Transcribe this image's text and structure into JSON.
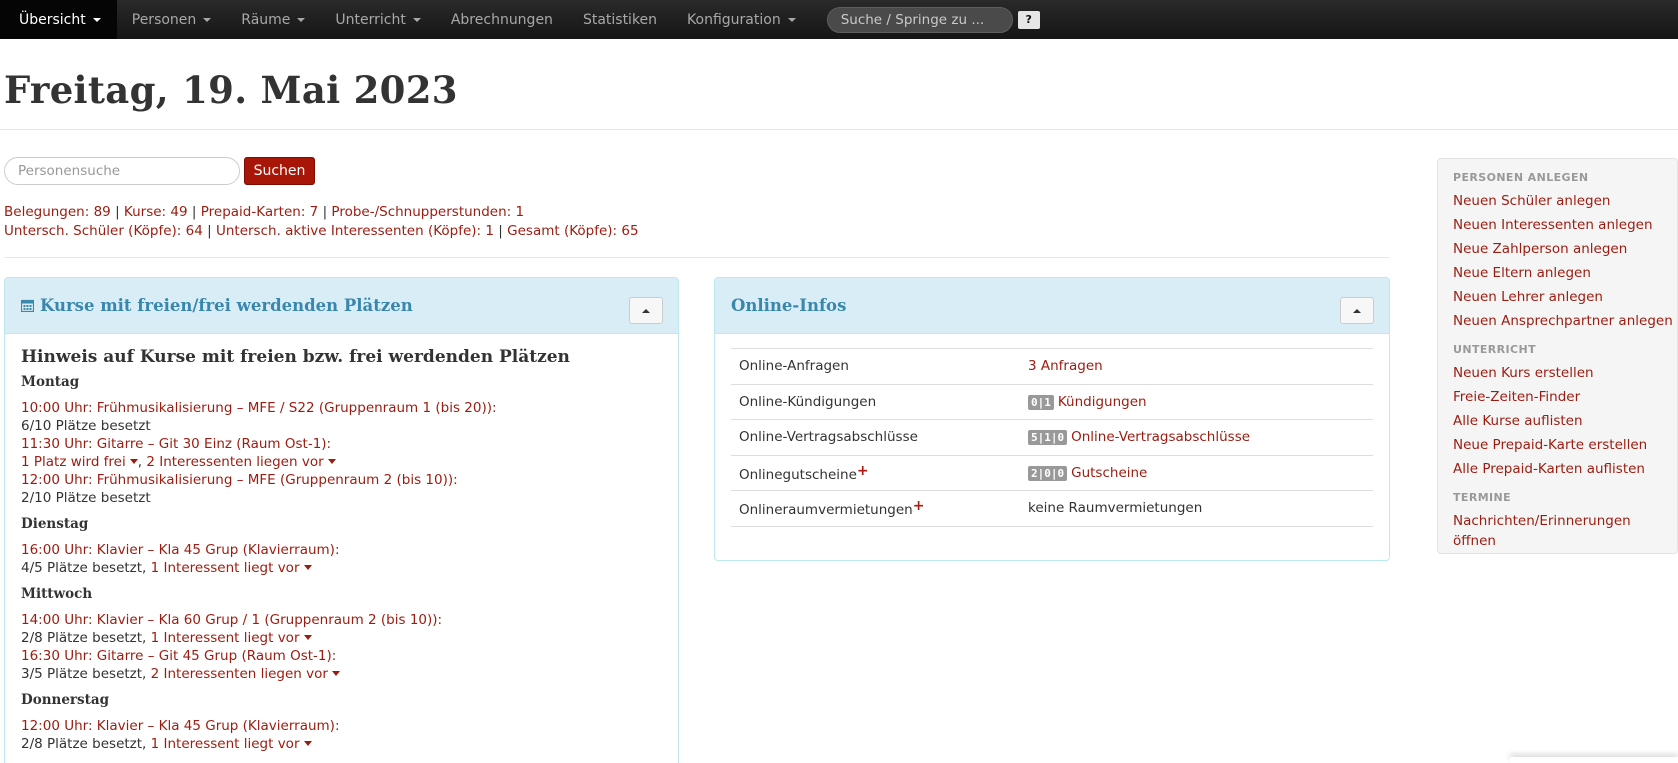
{
  "nav": {
    "items": [
      {
        "label": "Übersicht",
        "dropdown": true,
        "active": true
      },
      {
        "label": "Personen",
        "dropdown": true
      },
      {
        "label": "Räume",
        "dropdown": true
      },
      {
        "label": "Unterricht",
        "dropdown": true
      },
      {
        "label": "Abrechnungen",
        "dropdown": false
      },
      {
        "label": "Statistiken",
        "dropdown": false
      },
      {
        "label": "Konfiguration",
        "dropdown": true
      }
    ],
    "search_placeholder": "Suche / Springe zu ...",
    "help_label": "?"
  },
  "page": {
    "title": "Freitag, 19. Mai 2023",
    "person_search_placeholder": "Personensuche",
    "search_button": "Suchen"
  },
  "stats": {
    "line1": [
      "Belegungen: 89",
      "Kurse: 49",
      "Prepaid-Karten: 7",
      "Probe-/Schnupperstunden: 1"
    ],
    "line2": [
      "Untersch. Schüler (Köpfe): 64",
      "Untersch. aktive Interessenten (Köpfe): 1",
      "Gesamt (Köpfe): 65"
    ],
    "separator": "|"
  },
  "kurse_panel": {
    "title": "Kurse mit freien/frei werdenden Plätzen",
    "heading": "Hinweis auf Kurse mit freien bzw. frei werdenden Plätzen",
    "days": [
      {
        "name": "Montag",
        "courses": [
          {
            "title": "10:00 Uhr: Frühmusikalisierung – MFE / S22 (Gruppenraum 1 (bis 20)):",
            "status": "6/10 Plätze besetzt",
            "link": ""
          },
          {
            "title": "11:30 Uhr: Gitarre – Git 30 Einz (Raum Ost-1):",
            "status": "",
            "link": "1 Platz wird frei",
            "link2": "2 Interessenten liegen vor",
            "sep": ", "
          },
          {
            "title": "12:00 Uhr: Frühmusikalisierung – MFE (Gruppenraum 2 (bis 10)):",
            "status": "2/10 Plätze besetzt",
            "link": ""
          }
        ]
      },
      {
        "name": "Dienstag",
        "courses": [
          {
            "title": "16:00 Uhr: Klavier – Kla 45 Grup (Klavierraum):",
            "status": "4/5 Plätze besetzt, ",
            "link": "1 Interessent liegt vor"
          }
        ]
      },
      {
        "name": "Mittwoch",
        "courses": [
          {
            "title": "14:00 Uhr: Klavier – Kla 60 Grup / 1 (Gruppenraum 2 (bis 10)):",
            "status": "2/8 Plätze besetzt, ",
            "link": "1 Interessent liegt vor"
          },
          {
            "title": "16:30 Uhr: Gitarre – Git 45 Grup (Raum Ost-1):",
            "status": "3/5 Plätze besetzt, ",
            "link": "2 Interessenten liegen vor"
          }
        ]
      },
      {
        "name": "Donnerstag",
        "courses": [
          {
            "title": "12:00 Uhr: Klavier – Kla 45 Grup (Klavierraum):",
            "status": "2/8 Plätze besetzt, ",
            "link": "1 Interessent liegt vor"
          }
        ]
      }
    ]
  },
  "online_panel": {
    "title": "Online-Infos",
    "rows": [
      {
        "label": "Online-Anfragen",
        "plus": false,
        "badge": "",
        "value": "3 Anfragen",
        "value_is_link": true
      },
      {
        "label": "Online-Kündigungen",
        "plus": false,
        "badge": "0|1",
        "value": "Kündigungen",
        "value_is_link": true
      },
      {
        "label": "Online-Vertragsabschlüsse",
        "plus": false,
        "badge": "5|1|0",
        "value": "Online-Vertragsabschlüsse",
        "value_is_link": true
      },
      {
        "label": "Onlinegutscheine",
        "plus": true,
        "badge": "2|0|0",
        "value": "Gutscheine",
        "value_is_link": true
      },
      {
        "label": "Onlineraumvermietungen",
        "plus": true,
        "badge": "",
        "value": "keine Raumvermietungen",
        "value_is_link": false
      }
    ],
    "plus_symbol": "+"
  },
  "sidebar": {
    "sections": [
      {
        "header": "PERSONEN ANLEGEN",
        "links": [
          "Neuen Schüler anlegen",
          "Neuen Interessenten anlegen",
          "Neue Zahlperson anlegen",
          "Neue Eltern anlegen",
          "Neuen Lehrer anlegen",
          "Neuen Ansprechpartner anlegen"
        ]
      },
      {
        "header": "UNTERRICHT",
        "links": [
          "Neuen Kurs erstellen",
          "Freie-Zeiten-Finder",
          "Alle Kurse auflisten",
          "Neue Prepaid-Karte erstellen",
          "Alle Prepaid-Karten auflisten"
        ]
      },
      {
        "header": "TERMINE",
        "links": [
          "Nachrichten/Erinnerungen öffnen"
        ]
      }
    ]
  },
  "colors": {
    "accent": "#9b1c10",
    "panel_head_bg": "#d9edf7",
    "panel_title": "#3a87ad",
    "navbar": "#1b1b1b"
  }
}
